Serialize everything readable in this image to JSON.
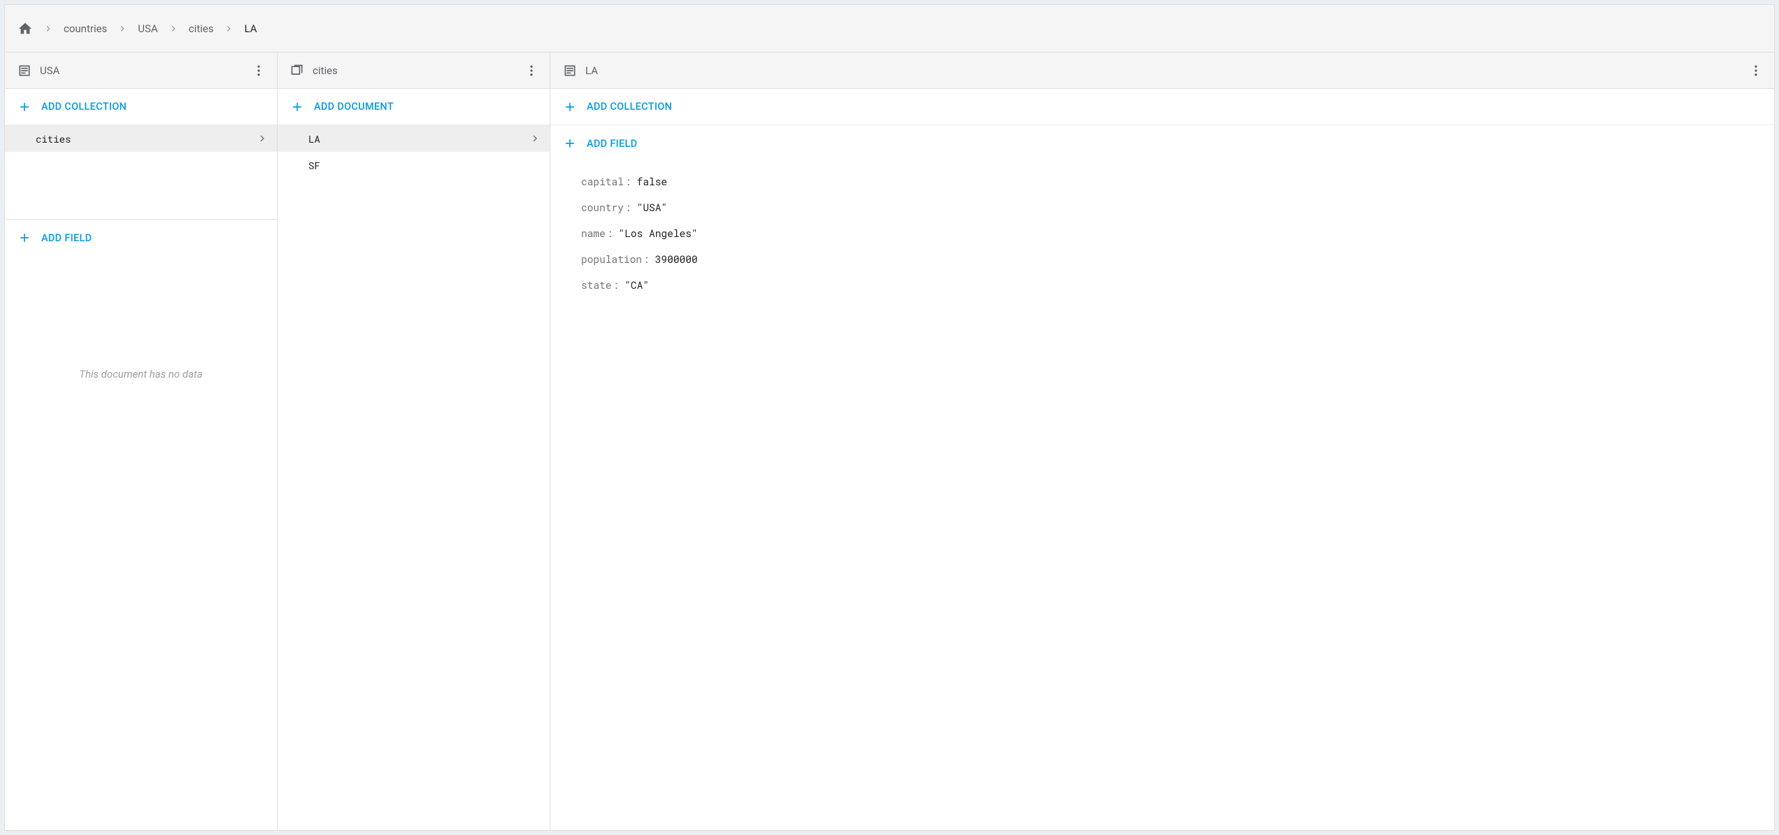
{
  "breadcrumb": {
    "items": [
      "countries",
      "USA",
      "cities",
      "LA"
    ]
  },
  "panel1": {
    "title": "USA",
    "add_collection_label": "ADD COLLECTION",
    "add_field_label": "ADD FIELD",
    "collections": [
      {
        "name": "cities",
        "selected": true
      }
    ],
    "empty_message": "This document has no data"
  },
  "panel2": {
    "title": "cities",
    "add_document_label": "ADD DOCUMENT",
    "documents": [
      {
        "name": "LA",
        "selected": true
      },
      {
        "name": "SF",
        "selected": false
      }
    ]
  },
  "panel3": {
    "title": "LA",
    "add_collection_label": "ADD COLLECTION",
    "add_field_label": "ADD FIELD",
    "fields": [
      {
        "key": "capital",
        "value": "false"
      },
      {
        "key": "country",
        "value": "\"USA\""
      },
      {
        "key": "name",
        "value": "\"Los Angeles\""
      },
      {
        "key": "population",
        "value": "3900000"
      },
      {
        "key": "state",
        "value": "\"CA\""
      }
    ]
  }
}
